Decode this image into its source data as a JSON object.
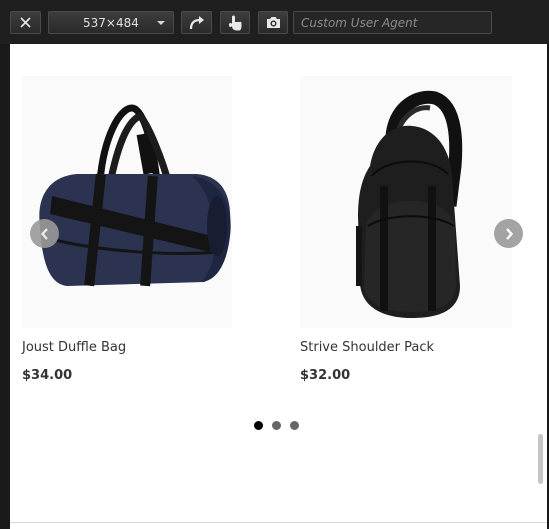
{
  "toolbar": {
    "viewport_size": "537×484",
    "user_agent_placeholder": "Custom User Agent",
    "icons": [
      "close-icon",
      "chevron-down-icon",
      "rotate-icon",
      "touch-icon",
      "camera-icon"
    ]
  },
  "products": [
    {
      "name": "Joust Duffle Bag",
      "price": "$34.00",
      "image": "duffle-bag"
    },
    {
      "name": "Strive Shoulder Pack",
      "price": "$32.00",
      "image": "shoulder-pack"
    }
  ],
  "carousel": {
    "dots": 3,
    "active_dot": 1,
    "arrows": [
      "chevron-left-icon",
      "chevron-right-icon"
    ]
  },
  "colors": {
    "toolbar_bg": "#1f1f1f",
    "page_bg": "#ffffff",
    "text": "#333333",
    "arrow_bg": "#9a9a9a",
    "dot_active": "#000000",
    "dot_inactive": "#666666"
  }
}
